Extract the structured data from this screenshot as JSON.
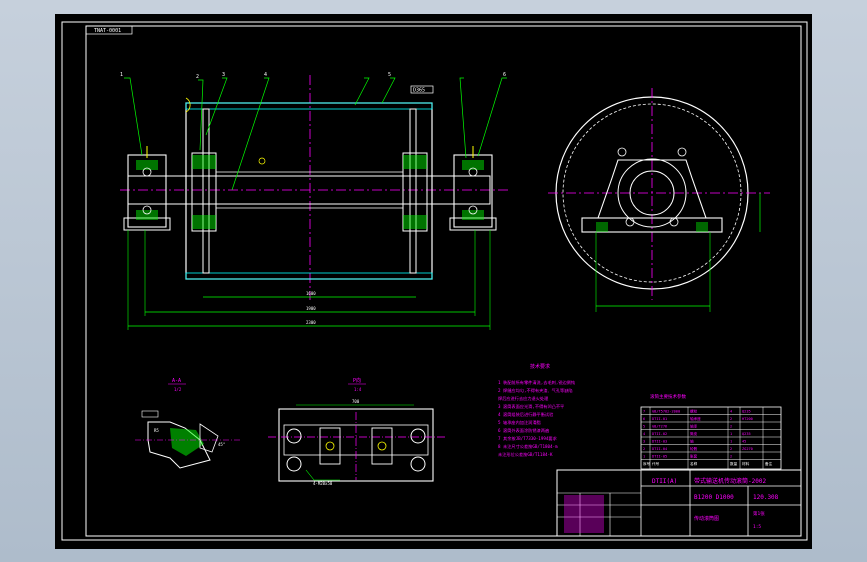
{
  "drawing": {
    "title_tab": "TNAT-0001",
    "balloons": [
      "1",
      "2",
      "3",
      "4",
      "5",
      "6"
    ],
    "dim_tag": "D365",
    "section_label": "A-A",
    "section_scale": "1/2",
    "plan_label": "P向",
    "plan_scale": "1:4",
    "top_dim": "700",
    "bottom_note": "4-M20x50",
    "section_angle": "45°",
    "section_note": "R5",
    "dims_bottom": [
      "1600",
      "1900",
      "2300"
    ],
    "notes_title": "技术要求",
    "notes": [
      "1 装配前所有零件清洗,去毛刺,锐边倒钝",
      "2 焊缝应均匀,不得有夹渣、气孔等缺陷",
      "  焊后应进行去应力退火处理",
      "3 滚筒表面应光滑,不得有凹凸不平",
      "4 滚筒组装后进行静平衡试验",
      "5 轴承座内加注润滑脂",
      "6 滚筒外表面涂防锈漆两遍",
      "7 其余按JB/T7330-1994要求",
      "8 未注尺寸公差按GB/T1804-m",
      "  未注形位公差按GB/T1184-K"
    ],
    "table_header": "滚筒主要技术参数",
    "parts": [
      [
        "7",
        "GB/T5782-2000",
        "螺栓",
        "4",
        "Q235",
        ""
      ],
      [
        "6",
        "DTII-01",
        "轴承座",
        "2",
        "HT200",
        ""
      ],
      [
        "5",
        "GB/T276",
        "轴承",
        "2",
        "",
        ""
      ],
      [
        "4",
        "DTII-02",
        "筒皮",
        "1",
        "Q235",
        ""
      ],
      [
        "3",
        "DTII-03",
        "轴",
        "1",
        "45",
        ""
      ],
      [
        "2",
        "DTII-04",
        "轮毂",
        "2",
        "ZG270",
        ""
      ],
      [
        "1",
        "DTII-05",
        "胀套",
        "2",
        "",
        ""
      ]
    ],
    "table_columns": [
      "序号",
      "代号",
      "名称",
      "数量",
      "材料",
      "备注"
    ],
    "title_block": {
      "model": "DTII(A)",
      "name": "带式输送机传动滚筒-2002",
      "spec": "B1200 D1000",
      "drawing_no": "120.308",
      "assembly": "传动滚筒图",
      "sheet": "第1张",
      "scale": "1:5"
    }
  },
  "colors": {
    "white": "#ffffff",
    "magenta": "#ff00ff",
    "green": "#00ff00",
    "yellow": "#ffff00",
    "cyan": "#00ffff",
    "red": "#ff3030"
  }
}
